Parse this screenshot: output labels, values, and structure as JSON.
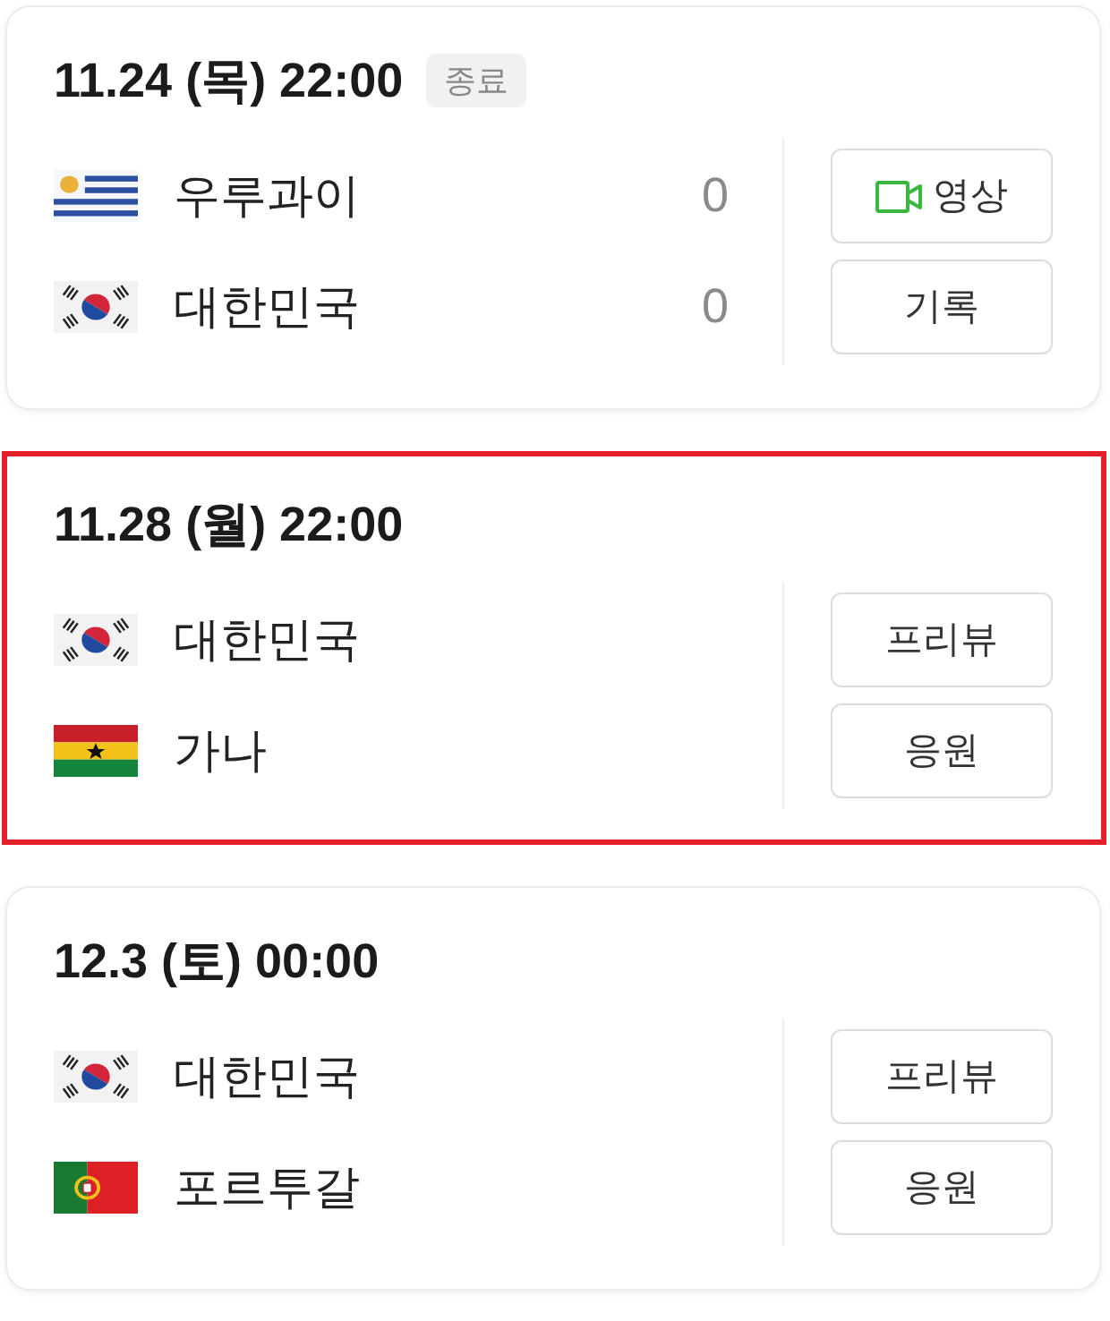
{
  "matches": [
    {
      "datetime": "11.24 (목) 22:00",
      "status": "종료",
      "highlighted": false,
      "teams": [
        {
          "name": "우루과이",
          "score": "0"
        },
        {
          "name": "대한민국",
          "score": "0"
        }
      ],
      "buttons": [
        {
          "label": "영상",
          "kind": "video"
        },
        {
          "label": "기록",
          "kind": "plain"
        }
      ]
    },
    {
      "datetime": "11.28 (월) 22:00",
      "highlighted": true,
      "teams": [
        {
          "name": "대한민국"
        },
        {
          "name": "가나"
        }
      ],
      "buttons": [
        {
          "label": "프리뷰",
          "kind": "plain"
        },
        {
          "label": "응원",
          "kind": "plain"
        }
      ]
    },
    {
      "datetime": "12.3 (토) 00:00",
      "highlighted": false,
      "teams": [
        {
          "name": "대한민국"
        },
        {
          "name": "포르투갈"
        }
      ],
      "buttons": [
        {
          "label": "프리뷰",
          "kind": "plain"
        },
        {
          "label": "응원",
          "kind": "plain"
        }
      ]
    }
  ]
}
